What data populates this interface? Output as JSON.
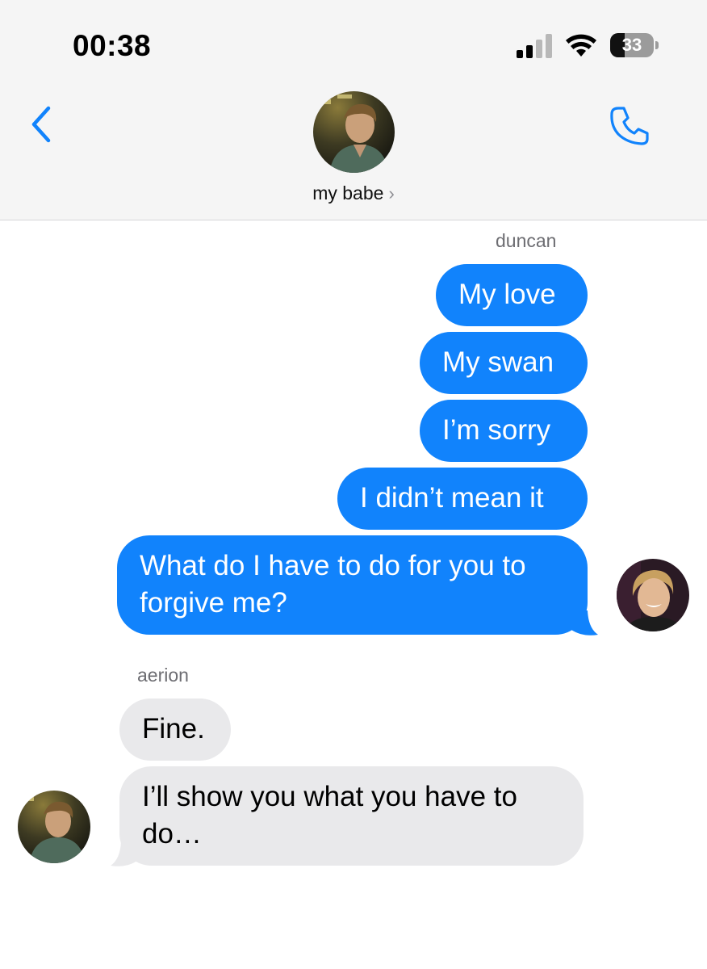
{
  "status_bar": {
    "time": "00:38",
    "battery": "33",
    "battery_level": 0.33
  },
  "header": {
    "contact_name": "my babe",
    "chevron": "›",
    "back_icon": "chevron-left-icon",
    "call_icon": "phone-icon",
    "accent_color": "#1183fc"
  },
  "conversation": {
    "outgoing_sender": "duncan",
    "outgoing": [
      {
        "text": "My love"
      },
      {
        "text": "My swan"
      },
      {
        "text": "I’m sorry"
      },
      {
        "text": "I didn’t mean it"
      },
      {
        "text": "What do I have to do for you to forgive me?"
      }
    ],
    "incoming_sender": "aerion",
    "incoming": [
      {
        "text": "Fine."
      },
      {
        "text": "I’ll show you what you have to do…"
      }
    ]
  }
}
